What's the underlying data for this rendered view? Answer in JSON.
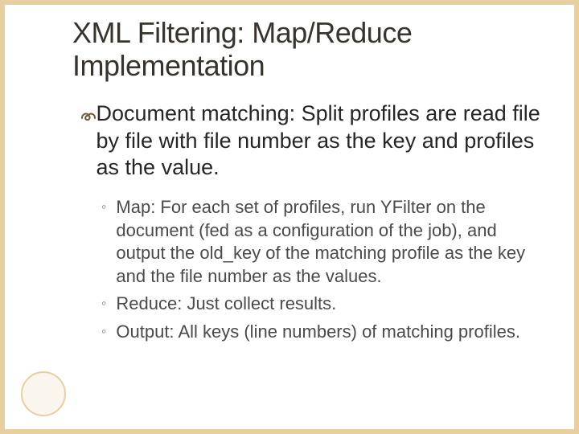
{
  "slide": {
    "title": "XML Filtering: Map/Reduce Implementation",
    "bullet1_glyph": "་",
    "main_point": "Document matching: Split profiles are read file by file with file number as the key and profiles as the value.",
    "sub_bullet_glyph": "◦",
    "sub_points": [
      "Map: For each set of profiles, run YFilter on the document (fed as a configuration of the job), and output the old_key of the matching profile as the key and the file number as the values.",
      "Reduce: Just collect results.",
      "Output: All keys (line numbers) of matching profiles."
    ]
  }
}
